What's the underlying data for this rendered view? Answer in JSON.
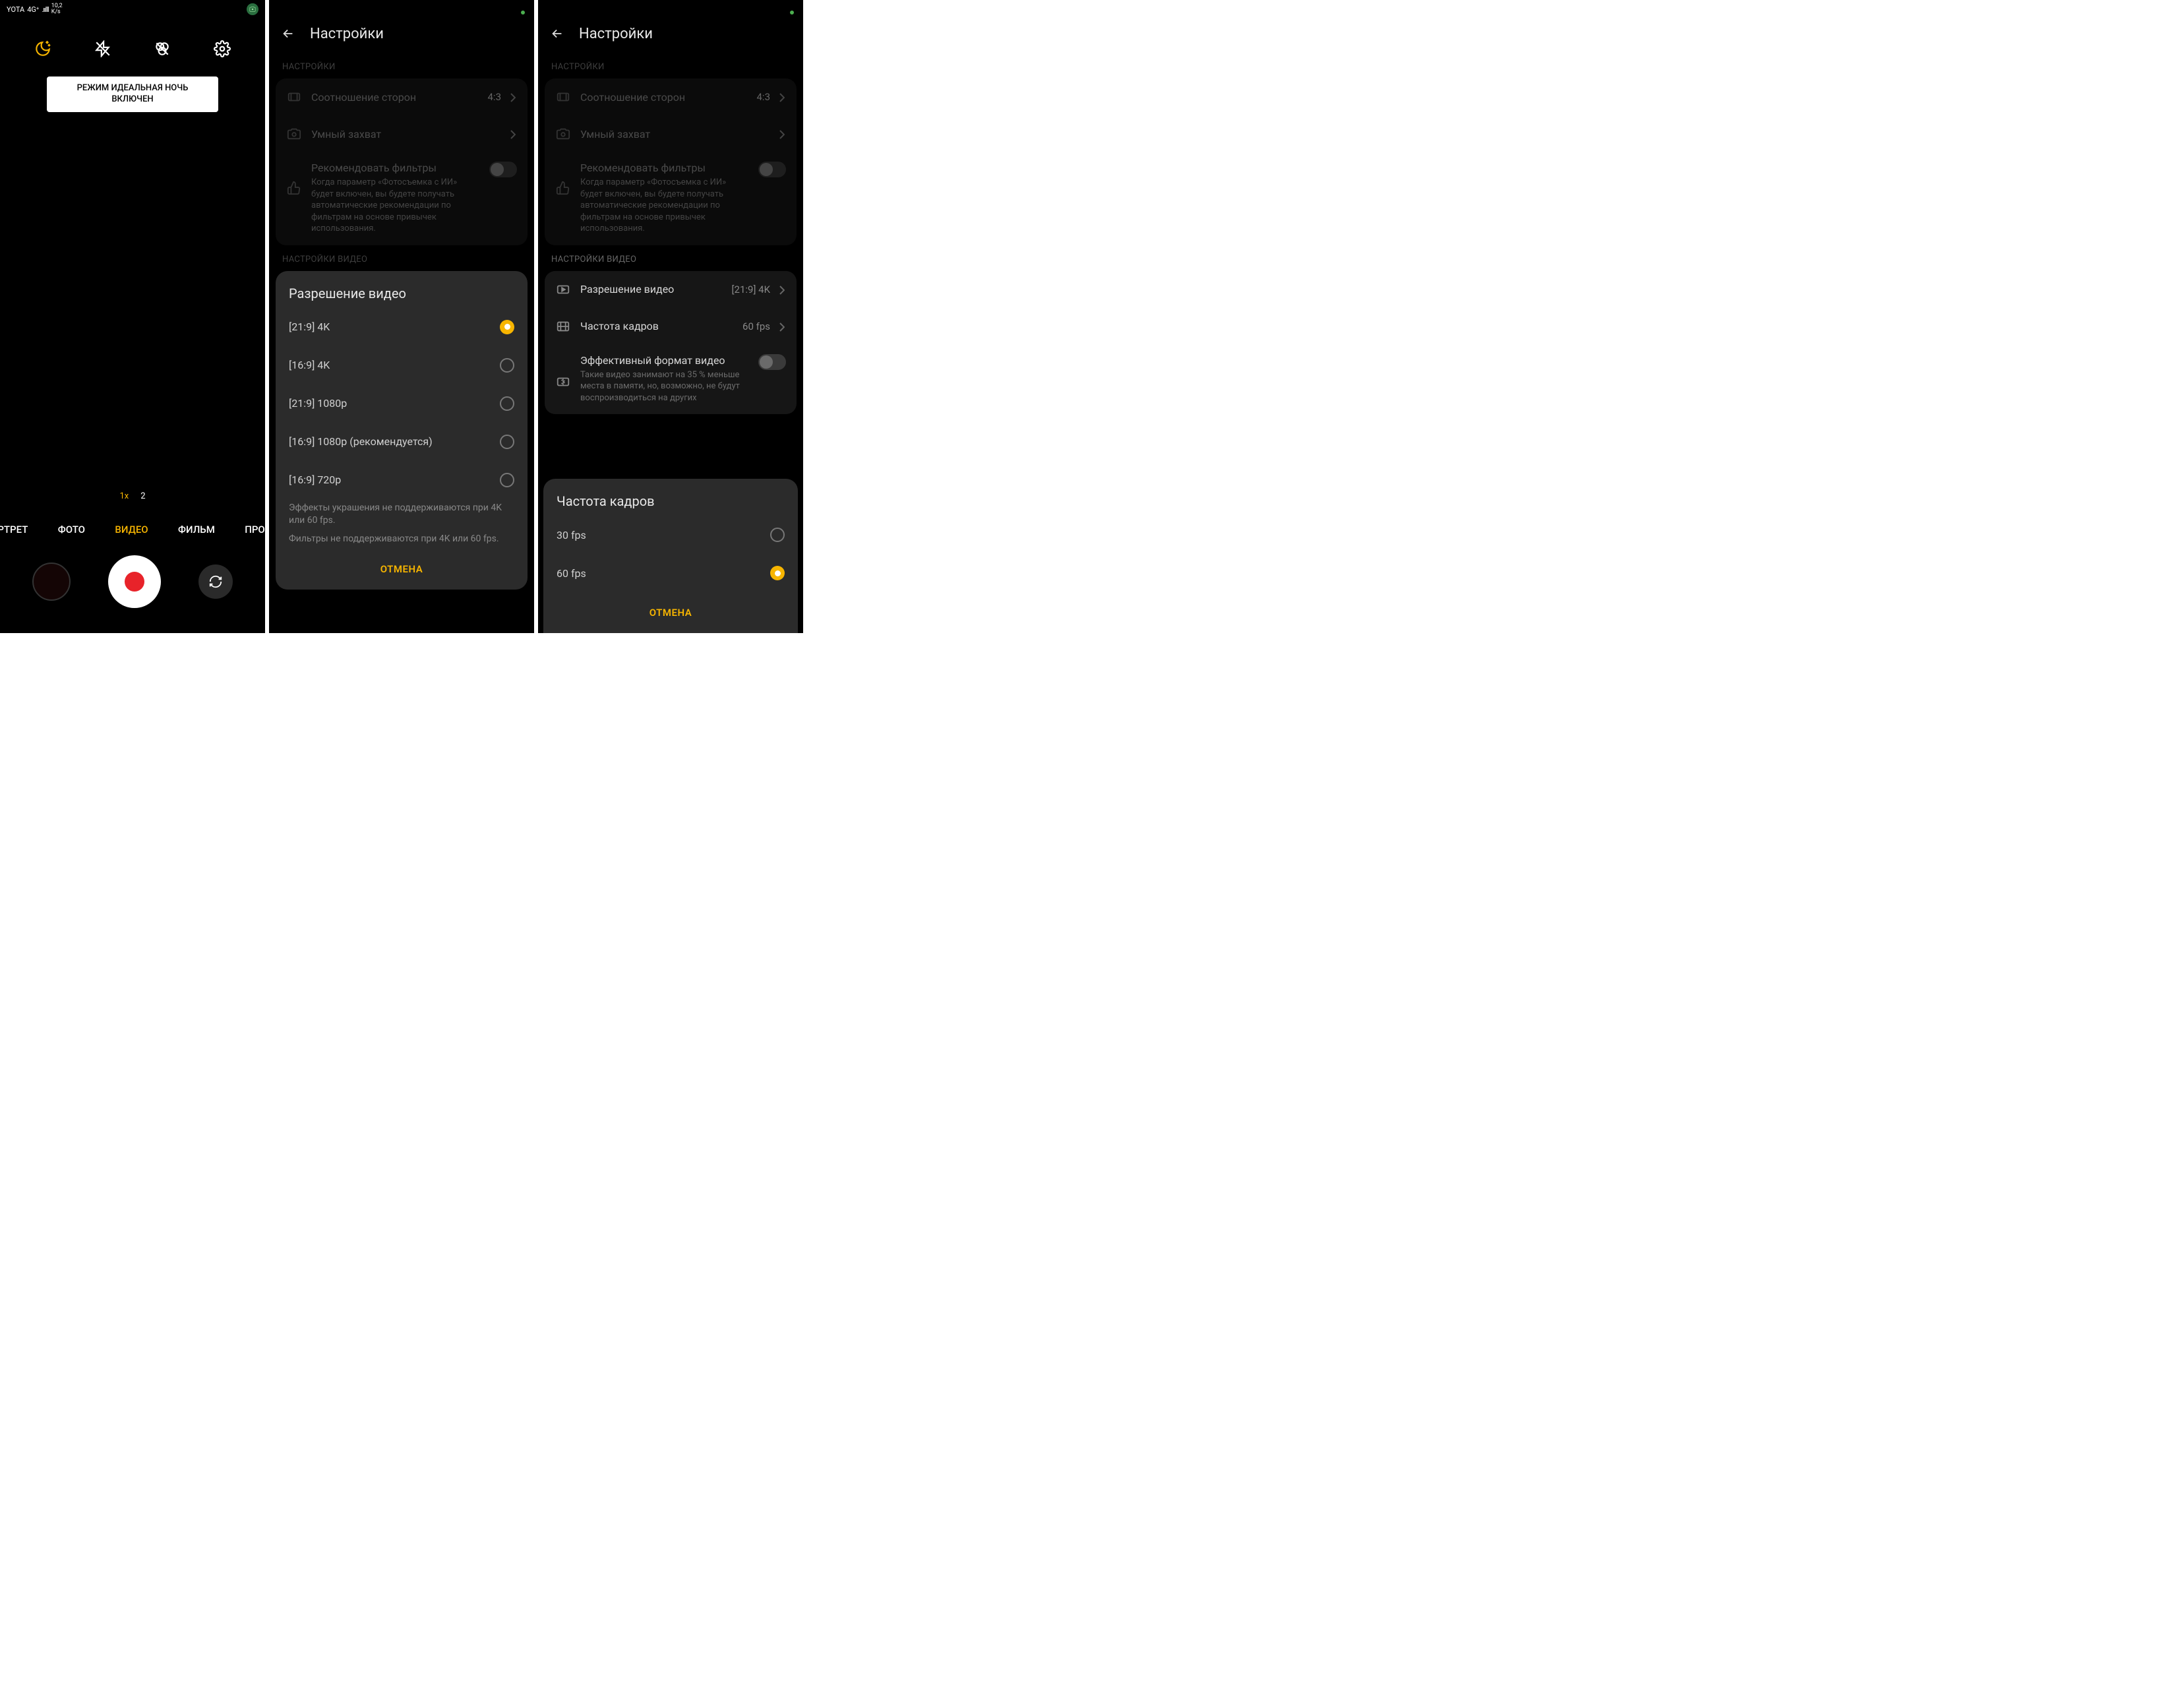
{
  "status": {
    "carrier": "YOTA",
    "net1": "4G⁺",
    "net2": "",
    "speed": "10,2\nK/s",
    "cam_badge_icon": "camera"
  },
  "camera": {
    "toast_line1": "РЕЖИМ ИДЕАЛЬНАЯ НОЧЬ",
    "toast_line2": "ВКЛЮЧЕН",
    "zoom": [
      "1x",
      "2"
    ],
    "zoom_active": 0,
    "modes": [
      "ОРТРЕТ",
      "ФОТО",
      "ВИДЕО",
      "ФИЛЬМ",
      "ПРОФІ"
    ],
    "modes_active": 2
  },
  "settings": {
    "title": "Настройки",
    "section_label": "НАСТРОЙКИ",
    "video_section_label": "НАСТРОЙКИ ВИДЕО",
    "aspect": {
      "label": "Соотношение сторон",
      "value": "4:3"
    },
    "smart": {
      "label": "Умный захват"
    },
    "filters": {
      "label": "Рекомендовать фильтры",
      "desc": "Когда параметр «Фотосъемка с ИИ» будет включен, вы будете получать автоматические рекомендации по фильтрам на основе привычек использования."
    },
    "resolution_row": {
      "label": "Разрешение видео",
      "value": "[21:9] 4K"
    },
    "framerate_row": {
      "label": "Частота кадров",
      "value": "60 fps"
    },
    "efficient": {
      "label": "Эффективный формат видео",
      "desc": "Такие видео занимают на 35 % меньше места в памяти, но, возможно, не будут воспроизводиться на других"
    }
  },
  "resolution_dialog": {
    "title": "Разрешение видео",
    "options": [
      "[21:9] 4K",
      "[16:9] 4K",
      "[21:9] 1080p",
      "[16:9] 1080p (рекомендуется)",
      "[16:9] 720p"
    ],
    "selected": 0,
    "note1": "Эффекты украшения не поддерживаются при 4K или 60 fps.",
    "note2": "Фильтры не поддерживаются при 4K или 60 fps.",
    "cancel": "ОТМЕНА"
  },
  "framerate_dialog": {
    "title": "Частота кадров",
    "options": [
      "30 fps",
      "60 fps"
    ],
    "selected": 1,
    "cancel": "ОТМЕНА"
  }
}
